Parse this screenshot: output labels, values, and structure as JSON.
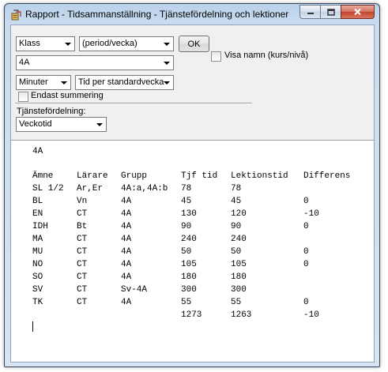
{
  "window": {
    "title": "Rapport - Tidsammanställning - Tjänstefördelning och lektioner"
  },
  "controls": {
    "klass_select": "Klass",
    "period_select": "(period/vecka)",
    "ok_label": "OK",
    "visa_namn_label": "Visa namn (kurs/nivå)",
    "visa_namn_checked": false,
    "class_select": "4A",
    "unit_select": "Minuter",
    "time_basis_select": "Tid per standardvecka",
    "endast_summering_label": "Endast summering",
    "endast_summering_checked": false,
    "tjanstefordelning_label": "Tjänstefördelning:",
    "tjanstefordelning_select": "Veckotid"
  },
  "report": {
    "heading": "4A",
    "columns": [
      "Ämne",
      "Lärare",
      "Grupp",
      "Tjf tid",
      "Lektionstid",
      "Differens"
    ],
    "rows": [
      [
        "SL 1/2",
        "Ar,Er",
        "4A:a,4A:b",
        "78",
        "78",
        ""
      ],
      [
        "BL",
        "Vn",
        "4A",
        "45",
        "45",
        "0"
      ],
      [
        "EN",
        "CT",
        "4A",
        "130",
        "120",
        "-10"
      ],
      [
        "IDH",
        "Bt",
        "4A",
        "90",
        "90",
        "0"
      ],
      [
        "MA",
        "CT",
        "4A",
        "240",
        "240",
        ""
      ],
      [
        "MU",
        "CT",
        "4A",
        "50",
        "50",
        "0"
      ],
      [
        "NO",
        "CT",
        "4A",
        "105",
        "105",
        "0"
      ],
      [
        "SO",
        "CT",
        "4A",
        "180",
        "180",
        ""
      ],
      [
        "SV",
        "CT",
        "Sv-4A",
        "300",
        "300",
        ""
      ],
      [
        "TK",
        "CT",
        "4A",
        "55",
        "55",
        "0"
      ]
    ],
    "totals": [
      "",
      "",
      "",
      "1273",
      "1263",
      "-10"
    ]
  }
}
